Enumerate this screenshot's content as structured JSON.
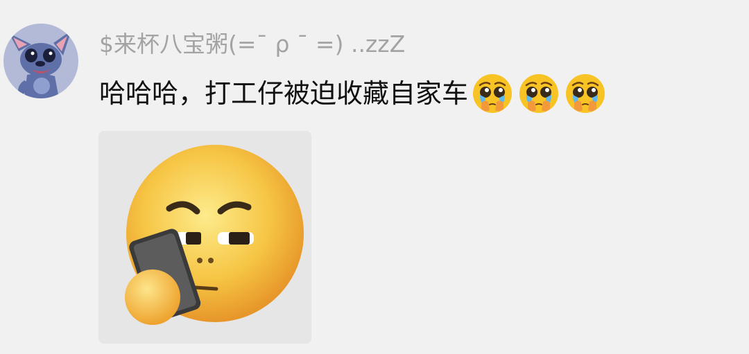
{
  "comment": {
    "username": "$来杯八宝粥(=ˉ ρ ˉ =) ..zzZ",
    "text": "哈哈哈，打工仔被迫收藏自家车",
    "emojis": [
      "pleading-face-icon",
      "pleading-face-icon",
      "pleading-face-icon"
    ]
  },
  "avatar": {
    "icon": "stitch-avatar"
  },
  "sticker": {
    "icon": "yellow-face-looking-at-phone-sticker"
  },
  "colors": {
    "background": "#f1f1f1",
    "username": "#a3a3a3",
    "text": "#111111",
    "emoji_yellow": "#f7c325"
  }
}
